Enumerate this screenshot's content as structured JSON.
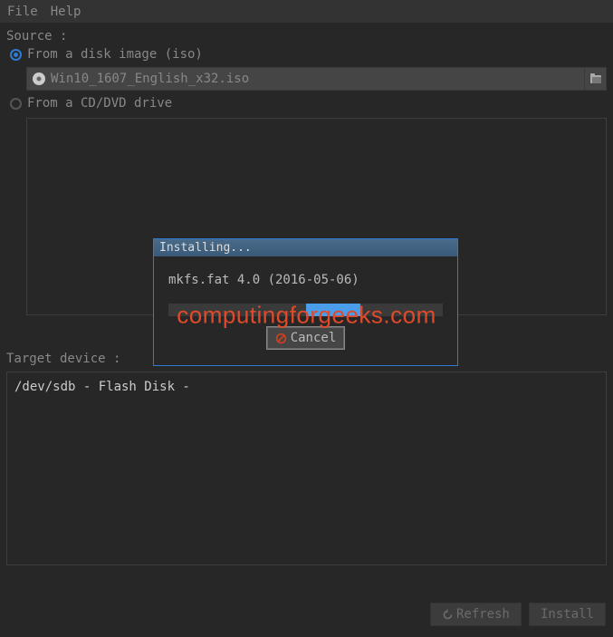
{
  "menu": {
    "file": "File",
    "help": "Help"
  },
  "source": {
    "label": "Source :",
    "option_iso": "From a disk image (iso)",
    "option_cd": "From a CD/DVD drive",
    "iso_file": "Win10_1607_English_x32.iso"
  },
  "target": {
    "label": "Target device :",
    "device": "/dev/sdb - Flash Disk -"
  },
  "buttons": {
    "refresh": "Refresh",
    "install": "Install",
    "cancel": "Cancel"
  },
  "dialog": {
    "title": "Installing...",
    "status": "mkfs.fat 4.0 (2016-05-06)"
  },
  "watermark": "computingforgeeks.com"
}
